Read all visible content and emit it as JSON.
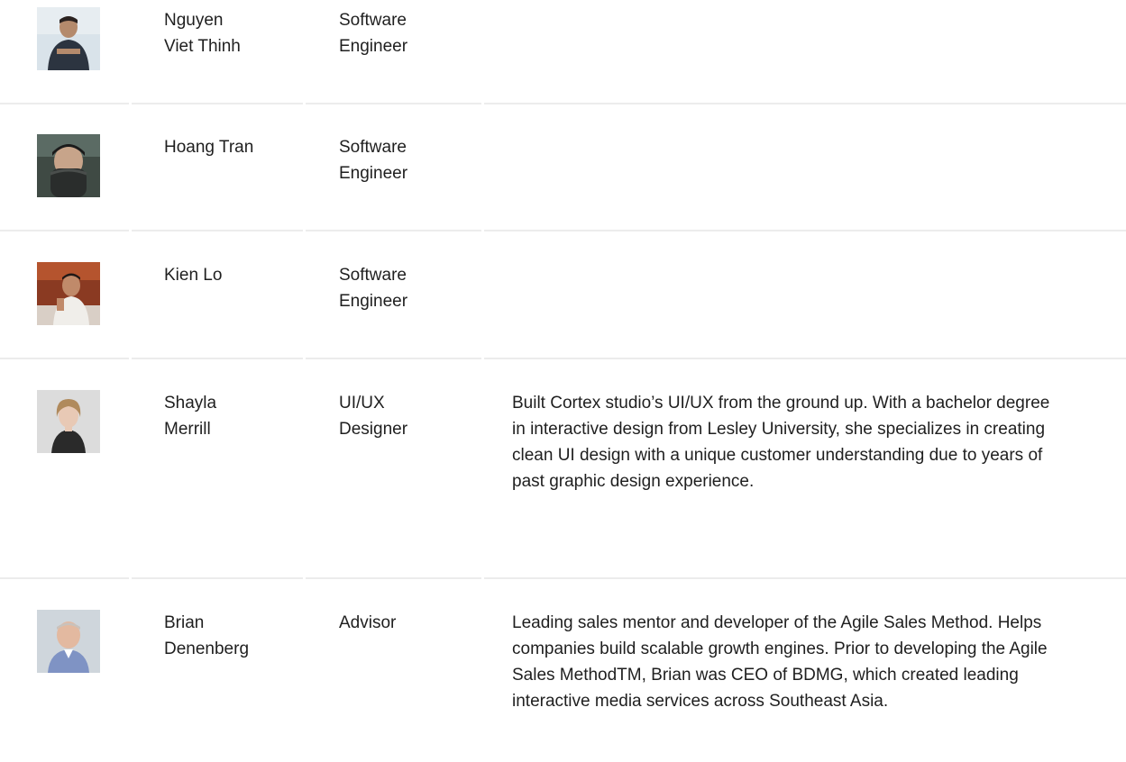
{
  "members": [
    {
      "name_line1": "Nguyen",
      "name_line2": "Viet Thinh",
      "role_line1": "Software",
      "role_line2": "Engineer",
      "bio": "",
      "avatar_icon": "person-photo-icon"
    },
    {
      "name_line1": "Hoang Tran",
      "name_line2": "",
      "role_line1": "Software",
      "role_line2": "Engineer",
      "bio": "",
      "avatar_icon": "person-photo-icon"
    },
    {
      "name_line1": "Kien Lo",
      "name_line2": "",
      "role_line1": "Software",
      "role_line2": "Engineer",
      "bio": "",
      "avatar_icon": "person-photo-icon"
    },
    {
      "name_line1": "Shayla",
      "name_line2": "Merrill",
      "role_line1": "UI/UX",
      "role_line2": "Designer",
      "bio": "Built Cortex studio’s UI/UX from the ground up. With a bachelor degree in interactive design from Lesley University, she specializes in creating clean UI design with a unique customer understanding due to years of past graphic design experience.",
      "avatar_icon": "person-photo-icon"
    },
    {
      "name_line1": "Brian",
      "name_line2": "Denenberg",
      "role_line1": "Advisor",
      "role_line2": "",
      "bio": "Leading sales mentor and developer of the Agile Sales Method. Helps companies build scalable growth engines. Prior to developing the Agile Sales MethodTM, Brian was CEO of BDMG, which created leading interactive media services across Southeast Asia.",
      "avatar_icon": "person-photo-icon"
    }
  ],
  "colors": {
    "text": "#1f1f1f",
    "divider": "#ececec"
  }
}
